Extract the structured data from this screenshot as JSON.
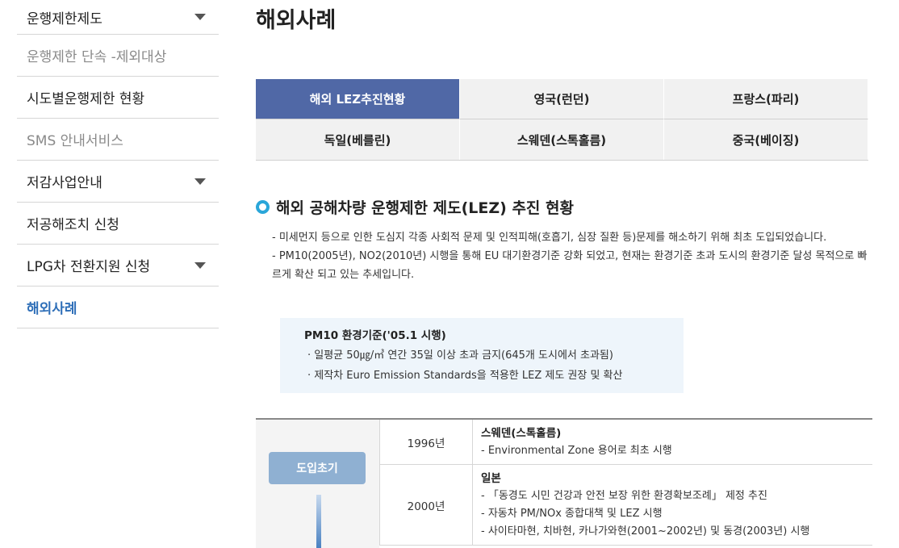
{
  "sidebar": {
    "items": [
      {
        "label": "운행제한제도",
        "state": "normal",
        "has_caret": true
      },
      {
        "label": "운행제한 단속 -제외대상",
        "state": "muted",
        "has_caret": false
      },
      {
        "label": "시도별운행제한 현황",
        "state": "normal",
        "has_caret": false
      },
      {
        "label": "SMS 안내서비스",
        "state": "muted",
        "has_caret": false
      },
      {
        "label": "저감사업안내",
        "state": "normal",
        "has_caret": true
      },
      {
        "label": "저공해조치 신청",
        "state": "normal",
        "has_caret": false
      },
      {
        "label": "LPG차 전환지원 신청",
        "state": "normal",
        "has_caret": true
      },
      {
        "label": "해외사례",
        "state": "active",
        "has_caret": false
      }
    ]
  },
  "main": {
    "title": "해외사례",
    "tabs": [
      {
        "label": "해외 LEZ추진현황",
        "active": true
      },
      {
        "label": "영국(런던)",
        "active": false
      },
      {
        "label": "프랑스(파리)",
        "active": false
      },
      {
        "label": "독일(베를린)",
        "active": false
      },
      {
        "label": "스웨덴(스톡홀름)",
        "active": false
      },
      {
        "label": "중국(베이징)",
        "active": false
      }
    ],
    "section_title": "해외 공해차량 운행제한 제도(LEZ) 추진 현황",
    "descriptions": [
      "- 미세먼지 등으로 인한 도심지 각종 사회적 문제 및 인적피해(호흡기, 심장 질환 등)문제를 해소하기 위해 최초 도입되었습니다.",
      "- PM10(2005년), NO2(2010년) 시행을 통해 EU 대기환경기준 강화 되었고, 현재는 환경기준 초과 도시의 환경기준 달성 목적으로 빠르게 확산 되고 있는 추세입니다."
    ],
    "infobox": {
      "title": "PM10 환경기준('05.1 시행)",
      "lines": [
        "· 일평균 50㎍/㎥ 연간 35일 이상 초과 금지(645개 도시에서 초과됨)",
        "· 제작차 Euro Emission Standards을 적용한 LEZ 제도 권장 및 확산"
      ]
    },
    "timeline": {
      "phase": "도입초기",
      "rows": [
        {
          "year": "1996년",
          "country": "스웨덴(스톡홀름)",
          "lines": [
            "- Environmental Zone 용어로 최초 시행"
          ]
        },
        {
          "year": "2000년",
          "country": "일본",
          "lines": [
            "- 「동경도 시민 건강과 안전 보장 위한 환경확보조례」 제정 추진",
            "- 자동차 PM/NOx 종합대책 및 LEZ 시행",
            "- 사이타마현, 치바현, 카나가와현(2001~2002년) 및 동경(2003년) 시행"
          ]
        }
      ]
    }
  },
  "colors": {
    "tab_active": "#5068a6",
    "sidebar_active": "#2f6fb8",
    "section_ring": "#2aa6d9",
    "phase_button": "#8fb0d2",
    "infobox_bg": "#eef5fb"
  },
  "icons": {
    "caret": "chevron-down-icon",
    "section_bullet": "ring-bullet-icon"
  }
}
